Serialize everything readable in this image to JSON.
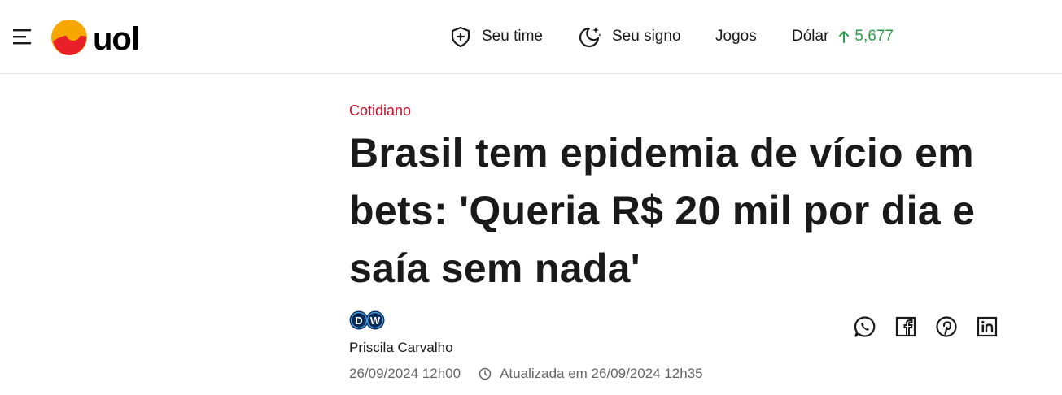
{
  "header": {
    "menu_icon": "hamburger-menu-icon",
    "logo": {
      "text": "uol",
      "colors": {
        "sun_outer": "#f7a800",
        "sun_inner": "#e8202a",
        "text": "#000000"
      }
    },
    "nav": {
      "seu_time": "Seu time",
      "seu_signo": "Seu signo",
      "jogos": "Jogos",
      "dolar_label": "Dólar",
      "dolar_value": "5,677",
      "dolar_trend": "up"
    }
  },
  "article": {
    "category": "Cotidiano",
    "headline": "Brasil tem epidemia de vício em bets: 'Queria R$ 20 mil por dia e saía sem nada'",
    "source_logo": "DW",
    "author": "Priscila Carvalho",
    "published": "26/09/2024 12h00",
    "updated": "Atualizada em 26/09/2024 12h35",
    "share": [
      "whatsapp-icon",
      "facebook-icon",
      "pinterest-icon",
      "linkedin-icon"
    ]
  },
  "colors": {
    "accent_red": "#c8102e",
    "positive_green": "#2e9e4a",
    "text": "#1a1a1a",
    "muted": "#666666"
  }
}
